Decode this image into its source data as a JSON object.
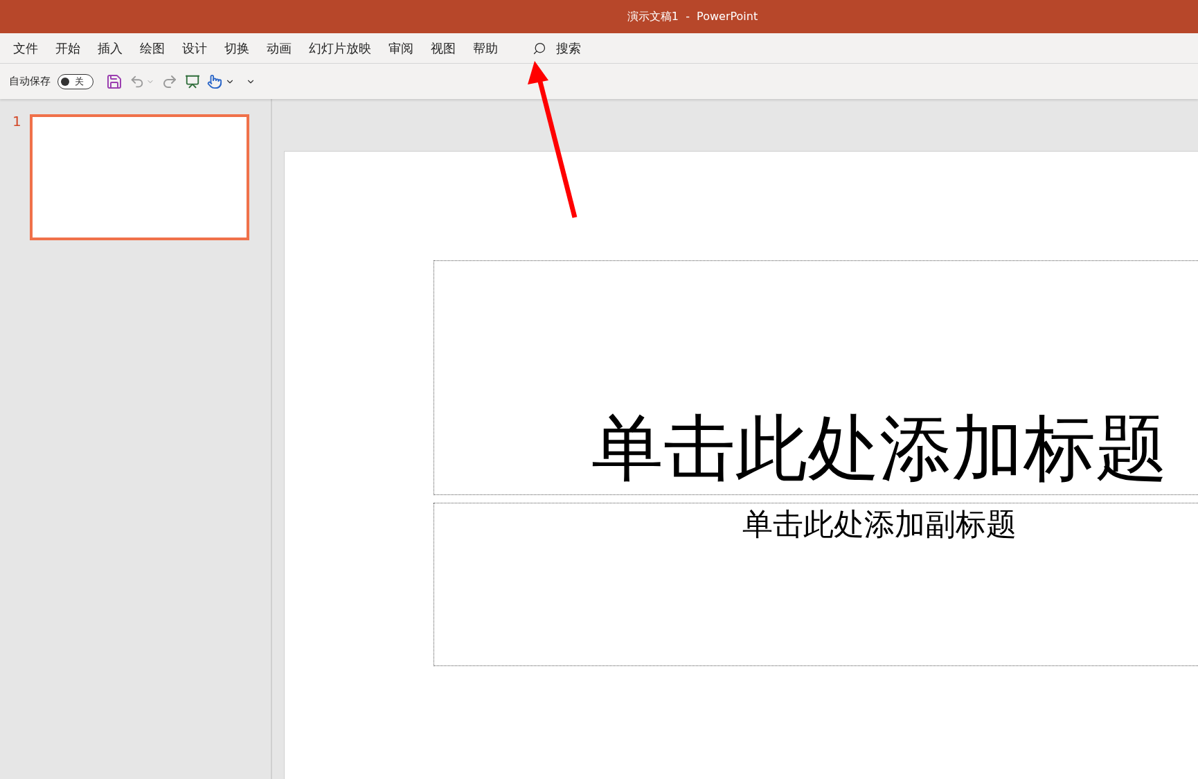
{
  "window": {
    "title": "演示文稿1  -  PowerPoint"
  },
  "menu": [
    {
      "label": "文件"
    },
    {
      "label": "开始"
    },
    {
      "label": "插入"
    },
    {
      "label": "绘图"
    },
    {
      "label": "设计"
    },
    {
      "label": "切换"
    },
    {
      "label": "动画"
    },
    {
      "label": "幻灯片放映"
    },
    {
      "label": "审阅"
    },
    {
      "label": "视图"
    },
    {
      "label": "帮助"
    }
  ],
  "search": {
    "label": "搜索"
  },
  "quick_access": {
    "autosave": {
      "label": "自动保存",
      "on": false,
      "state_text": "关"
    }
  },
  "slides": [
    {
      "number": "1",
      "selected": true
    }
  ],
  "slide": {
    "title_placeholder": "单击此处添加标题",
    "subtitle_placeholder": "单击此处添加副标题"
  }
}
